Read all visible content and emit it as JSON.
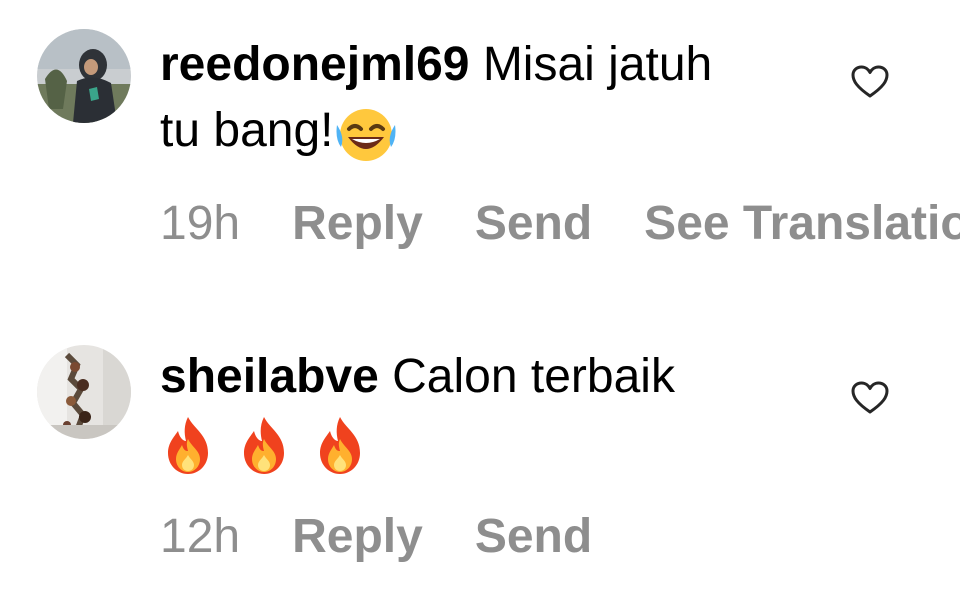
{
  "comments": [
    {
      "username": "reedonejml69",
      "text": "Misai jatuh tu bang!",
      "emoji": [
        "face-with-tears-of-joy"
      ],
      "time": "19h",
      "actions": [
        "Reply",
        "Send",
        "See Translation"
      ],
      "like_icon": "heart-outline-icon"
    },
    {
      "username": "sheilabve",
      "text": "Calon terbaik",
      "emoji": [
        "fire",
        "fire",
        "fire"
      ],
      "time": "12h",
      "actions": [
        "Reply",
        "Send"
      ],
      "like_icon": "heart-outline-icon"
    }
  ],
  "colors": {
    "text": "#000000",
    "secondary": "#8e8e8e",
    "background": "#ffffff"
  }
}
